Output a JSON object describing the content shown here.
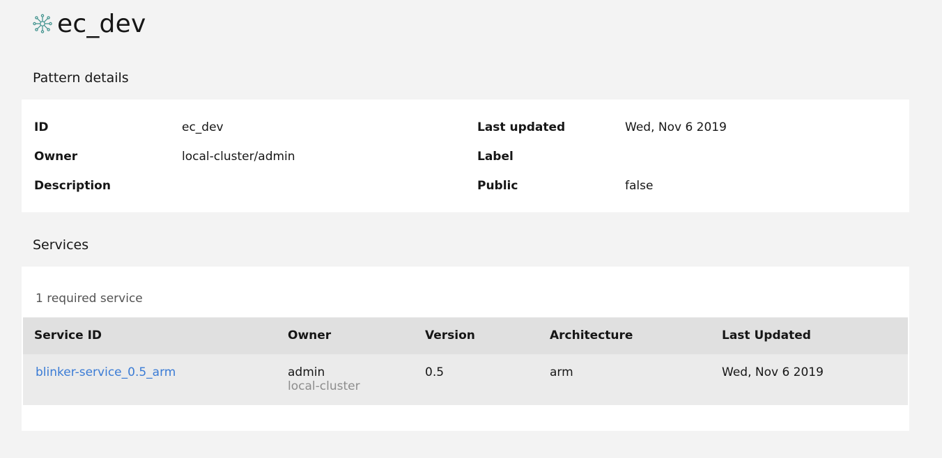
{
  "header": {
    "title": "ec_dev",
    "icon": "pattern-network-icon",
    "icon_color": "#3a8f8a"
  },
  "details": {
    "heading": "Pattern details",
    "fields": {
      "id": {
        "label": "ID",
        "value": "ec_dev"
      },
      "owner": {
        "label": "Owner",
        "value": "local-cluster/admin"
      },
      "description": {
        "label": "Description",
        "value": ""
      },
      "last_updated": {
        "label": "Last updated",
        "value": "Wed, Nov 6 2019"
      },
      "label": {
        "label": "Label",
        "value": ""
      },
      "public": {
        "label": "Public",
        "value": "false"
      }
    }
  },
  "services": {
    "heading": "Services",
    "count_text": "1 required service",
    "columns": [
      "Service ID",
      "Owner",
      "Version",
      "Architecture",
      "Last Updated"
    ],
    "rows": [
      {
        "service_id": "blinker-service_0.5_arm",
        "owner": "admin",
        "owner_org": "local-cluster",
        "version": "0.5",
        "architecture": "arm",
        "last_updated": "Wed, Nov 6 2019"
      }
    ]
  },
  "colors": {
    "link": "#3a7bd5",
    "page_bg": "#f3f3f3",
    "card_bg": "#ffffff",
    "table_header": "#e0e0e0",
    "table_row": "#ebebeb"
  }
}
